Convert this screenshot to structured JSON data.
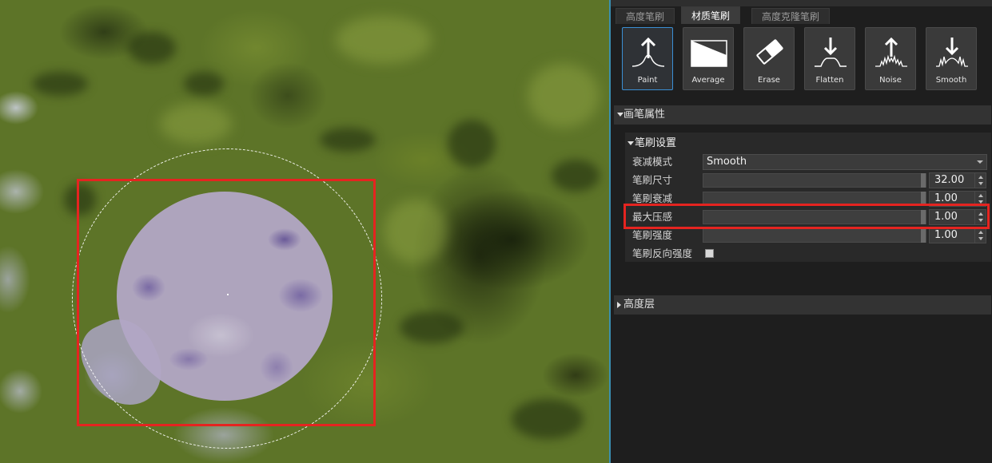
{
  "panel": {
    "tabs": [
      {
        "label": "高度笔刷",
        "active": false
      },
      {
        "label": "材质笔刷",
        "active": true
      },
      {
        "label": "高度克隆笔刷",
        "active": false
      }
    ],
    "tools": [
      {
        "label": "Paint",
        "icon": "paint-up-arrow-icon",
        "active": true
      },
      {
        "label": "Average",
        "icon": "average-hatch-icon",
        "active": false
      },
      {
        "label": "Erase",
        "icon": "eraser-icon",
        "active": false
      },
      {
        "label": "Flatten",
        "icon": "flatten-down-arrow-icon",
        "active": false
      },
      {
        "label": "Noise",
        "icon": "noise-up-arrow-icon",
        "active": false
      },
      {
        "label": "Smooth",
        "icon": "smooth-down-arrow-icon",
        "active": false
      }
    ],
    "sections": {
      "brush_properties": "画笔属性",
      "brush_settings": "笔刷设置",
      "height_layer": "高度层"
    },
    "settings": {
      "falloff_mode": {
        "label": "衰减模式",
        "value": "Smooth"
      },
      "brush_size": {
        "label": "笔刷尺寸",
        "value": "32.00",
        "fraction": 0.99
      },
      "brush_falloff": {
        "label": "笔刷衰减",
        "value": "1.00",
        "fraction": 0.99
      },
      "max_pressure": {
        "label": "最大压感",
        "value": "1.00",
        "fraction": 0.99
      },
      "brush_strength": {
        "label": "笔刷强度",
        "value": "1.00",
        "fraction": 0.99
      },
      "brush_invert_strength": {
        "label": "笔刷反向强度",
        "checked": false
      }
    }
  },
  "colors": {
    "highlight": "#e52420",
    "active_tool_border": "#3b8fd4",
    "panel_bg": "#1e1e1e",
    "terrain_green": "#5d7428",
    "brush_purple": "#b3a7c6"
  }
}
